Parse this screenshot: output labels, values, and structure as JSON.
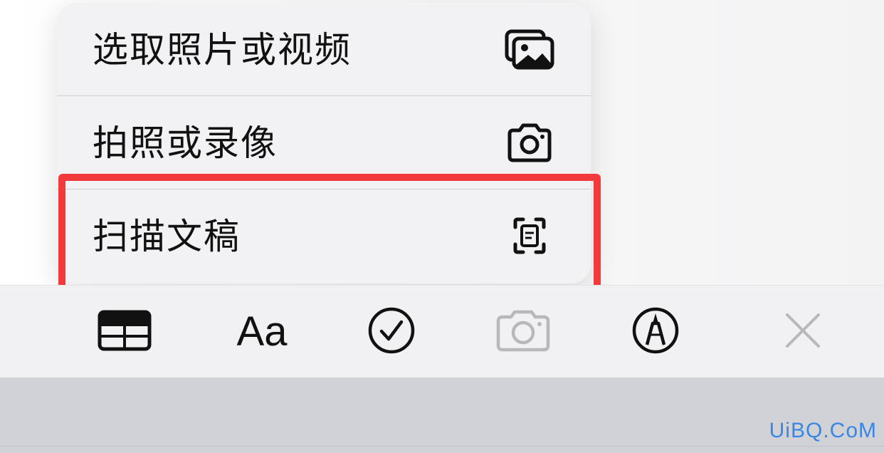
{
  "menu": {
    "items": [
      {
        "label": "选取照片或视频",
        "icon": "photo-library-icon"
      },
      {
        "label": "拍照或录像",
        "icon": "camera-icon"
      },
      {
        "label": "扫描文稿",
        "icon": "document-scan-icon"
      }
    ]
  },
  "toolbar": {
    "tools": [
      {
        "name": "table",
        "icon": "table-icon"
      },
      {
        "name": "format",
        "label": "Aa",
        "icon": "text-format-icon"
      },
      {
        "name": "checklist",
        "icon": "checklist-icon"
      },
      {
        "name": "camera",
        "icon": "camera-icon",
        "state": "disabled"
      },
      {
        "name": "markup",
        "icon": "markup-pen-icon"
      },
      {
        "name": "close",
        "icon": "close-icon",
        "state": "disabled"
      }
    ]
  },
  "highlight": {
    "color": "#f2393b",
    "target": "扫描文稿"
  },
  "watermark": {
    "text": "UiBQ.CoM",
    "color": "#3a86e8"
  },
  "colors": {
    "menu_bg": "#f2f2f4",
    "toolbar_bg": "#f1f1f3",
    "bottom_bg": "#d1d2d6",
    "disabled_icon": "#b8b8bb"
  }
}
